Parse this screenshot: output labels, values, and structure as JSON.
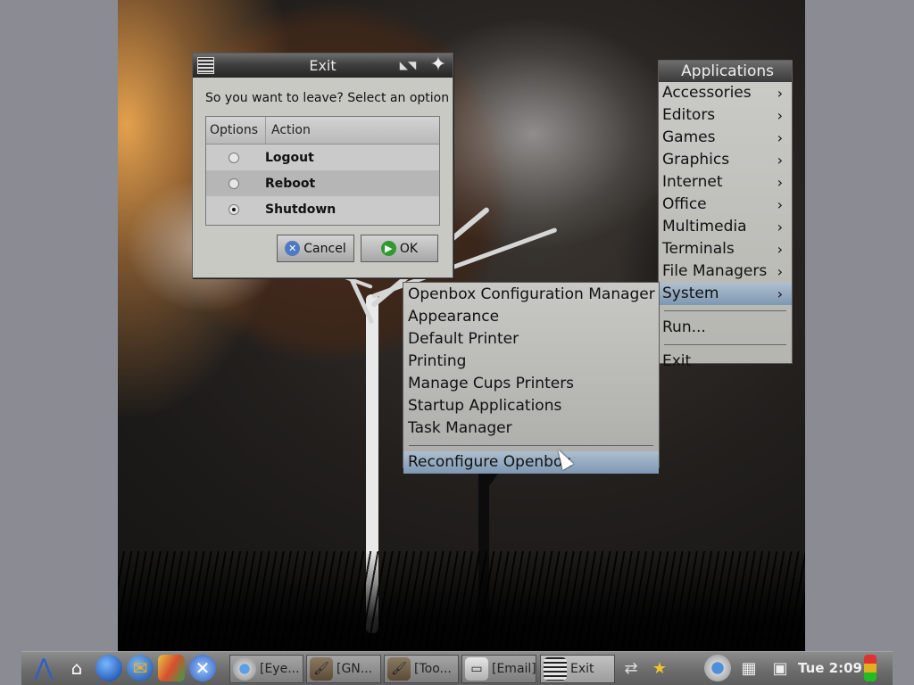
{
  "exit_dialog": {
    "title": "Exit",
    "prompt": "So you want to leave?  Select an option",
    "columns": {
      "options": "Options",
      "action": "Action"
    },
    "options": [
      {
        "label": "Logout",
        "selected": false
      },
      {
        "label": "Reboot",
        "selected": false
      },
      {
        "label": "Shutdown",
        "selected": true
      }
    ],
    "cancel_label": "Cancel",
    "ok_label": "OK",
    "icons": [
      "window-menu-icon",
      "iconify-icon",
      "close-icon",
      "cancel-icon",
      "ok-icon"
    ]
  },
  "applications_menu": {
    "title": "Applications",
    "items": [
      {
        "label": "Accessories",
        "submenu": true
      },
      {
        "label": "Editors",
        "submenu": true
      },
      {
        "label": "Games",
        "submenu": true
      },
      {
        "label": "Graphics",
        "submenu": true
      },
      {
        "label": "Internet",
        "submenu": true
      },
      {
        "label": "Office",
        "submenu": true
      },
      {
        "label": "Multimedia",
        "submenu": true
      },
      {
        "label": "Terminals",
        "submenu": true
      },
      {
        "label": "File Managers",
        "submenu": true
      },
      {
        "label": "System",
        "submenu": true,
        "active": true
      }
    ],
    "run_label": "Run...",
    "exit_label": "Exit",
    "arrow": "›"
  },
  "system_menu": {
    "items": [
      "Openbox Configuration Manager",
      "Appearance",
      "Default Printer",
      "Printing",
      "Manage Cups Printers",
      "Startup Applications",
      "Task Manager"
    ],
    "highlighted": "Reconfigure Openbox"
  },
  "taskbar": {
    "launchers": [
      "start-menu-icon",
      "home-folder-icon",
      "web-browser-icon",
      "email-client-icon",
      "paint-icon",
      "settings-icon"
    ],
    "tasks": [
      {
        "label": "[Eye...",
        "icon": "chrome-icon"
      },
      {
        "label": "[GN...",
        "icon": "gimp-icon"
      },
      {
        "label": "[Too...",
        "icon": "gimp-icon"
      },
      {
        "label": "[Email]",
        "icon": "folder-icon"
      },
      {
        "label": "Exit",
        "icon": "list-icon",
        "active": true
      }
    ],
    "tray_icons": [
      "network-icon",
      "mascot-icon",
      "chromium-icon",
      "calculator-icon",
      "monitor-icon",
      "traffic-light-icon"
    ],
    "clock": "Tue  2:09"
  },
  "colors": {
    "menu_highlight": "#8fa8c0",
    "panel": "#6f6f6f",
    "sunset": "#e8a552"
  }
}
